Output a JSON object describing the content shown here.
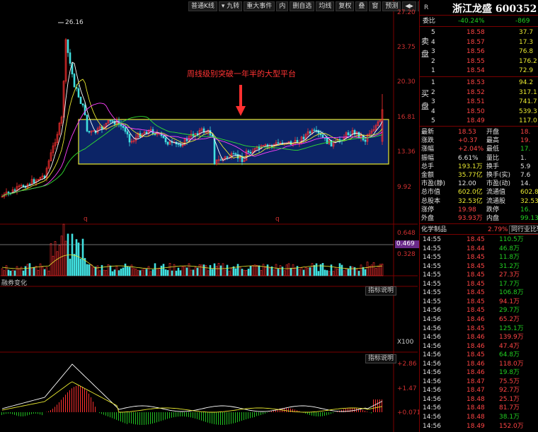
{
  "toolbar": [
    "普通K线",
    "▾ 九转",
    "重大事件",
    "内",
    "删自选",
    "均线",
    "复权",
    "叠",
    "窗",
    "预测",
    "◀▸",
    "▾"
  ],
  "price_axis": [
    "27.20",
    "23.75",
    "20.30",
    "16.81",
    "13.36",
    "9.92"
  ],
  "peak_label": "26.16",
  "annotation": "周线级别突破一年半的大型平台",
  "q_markers": [
    "q",
    "q"
  ],
  "vol_axis": [
    "0.648",
    "0.469",
    "0.328"
  ],
  "panel2": {
    "title": "融券变化",
    "btn": "指标说明",
    "axis": "X100"
  },
  "panel3": {
    "btn": "指标说明",
    "axis": [
      "+2.86",
      "+1.47",
      "+0.071"
    ]
  },
  "colors": {
    "up": "#ff3030",
    "down": "#40e0e0",
    "box": "#0c2466",
    "box_border": "#e8e830",
    "ma1": "#ffffff",
    "ma2": "#e8e830",
    "ma3": "#ff40ff",
    "ma4": "#30e030"
  },
  "quote": {
    "tag": "R",
    "name": "浙江龙盛",
    "code": "600352",
    "weibi_label": "委比",
    "weibi": "-40.24%",
    "weicha": "-869",
    "sell_label": [
      "卖",
      "盘"
    ],
    "buy_label": [
      "买",
      "盘"
    ],
    "sell": [
      {
        "lvl": "5",
        "price": "18.58",
        "vol": "37.7"
      },
      {
        "lvl": "4",
        "price": "18.57",
        "vol": "17.3"
      },
      {
        "lvl": "3",
        "price": "18.56",
        "vol": "76.8"
      },
      {
        "lvl": "2",
        "price": "18.55",
        "vol": "176.2"
      },
      {
        "lvl": "1",
        "price": "18.54",
        "vol": "72.9"
      }
    ],
    "buy": [
      {
        "lvl": "1",
        "price": "18.53",
        "vol": "94.2"
      },
      {
        "lvl": "2",
        "price": "18.52",
        "vol": "317.1"
      },
      {
        "lvl": "3",
        "price": "18.51",
        "vol": "741.7"
      },
      {
        "lvl": "4",
        "price": "18.50",
        "vol": "539.3"
      },
      {
        "lvl": "5",
        "price": "18.49",
        "vol": "117.0"
      }
    ],
    "stats": [
      {
        "l1": "最新",
        "v1": "18.53",
        "c1": "red",
        "l2": "开盘",
        "v2": "18.",
        "c2": "red"
      },
      {
        "l1": "涨跌",
        "v1": "+0.37",
        "c1": "red",
        "l2": "最高",
        "v2": "19.",
        "c2": "red"
      },
      {
        "l1": "涨幅",
        "v1": "+2.04%",
        "c1": "red",
        "l2": "最低",
        "v2": "17.",
        "c2": "green"
      },
      {
        "l1": "振幅",
        "v1": "6.61%",
        "c1": "white",
        "l2": "量比",
        "v2": "1.",
        "c2": "white"
      },
      {
        "l1": "总手",
        "v1": "193.1万",
        "c1": "yellow",
        "l2": "换手",
        "v2": "5.9",
        "c2": "white"
      },
      {
        "l1": "金额",
        "v1": "35.77亿",
        "c1": "yellow",
        "l2": "换手(实)",
        "v2": "7.6",
        "c2": "white"
      },
      {
        "l1": "市盈(静)",
        "v1": "12.00",
        "c1": "white",
        "l2": "市盈(动)",
        "v2": "14.",
        "c2": "white"
      },
      {
        "l1": "总市值",
        "v1": "602.0亿",
        "c1": "yellow",
        "l2": "流通值",
        "v2": "602.8",
        "c2": "yellow"
      },
      {
        "l1": "总股本",
        "v1": "32.53亿",
        "c1": "yellow",
        "l2": "流通股",
        "v2": "32.53",
        "c2": "yellow"
      },
      {
        "l1": "涨停",
        "v1": "19.98",
        "c1": "red",
        "l2": "跌停",
        "v2": "16.",
        "c2": "green"
      },
      {
        "l1": "外盘",
        "v1": "93.93万",
        "c1": "red",
        "l2": "内盘",
        "v2": "99.13",
        "c2": "green"
      }
    ],
    "industry": {
      "name": "化学制品",
      "pct": "2.79%",
      "btn": "同行业比较"
    },
    "ticks": [
      {
        "t": "14:55",
        "p": "18.45",
        "v": "110.5万",
        "c": "green"
      },
      {
        "t": "14:55",
        "p": "18.44",
        "v": "46.8万",
        "c": "green"
      },
      {
        "t": "14:55",
        "p": "18.45",
        "v": "11.8万",
        "c": "green"
      },
      {
        "t": "14:55",
        "p": "18.45",
        "v": "31.2万",
        "c": "green"
      },
      {
        "t": "14:55",
        "p": "18.45",
        "v": "27.3万",
        "c": "red"
      },
      {
        "t": "14:55",
        "p": "18.45",
        "v": "17.7万",
        "c": "green"
      },
      {
        "t": "14:55",
        "p": "18.45",
        "v": "106.8万",
        "c": "green"
      },
      {
        "t": "14:55",
        "p": "18.45",
        "v": "94.1万",
        "c": "red"
      },
      {
        "t": "14:56",
        "p": "18.45",
        "v": "29.7万",
        "c": "green"
      },
      {
        "t": "14:56",
        "p": "18.46",
        "v": "65.2万",
        "c": "red"
      },
      {
        "t": "14:56",
        "p": "18.45",
        "v": "125.1万",
        "c": "green"
      },
      {
        "t": "14:56",
        "p": "18.46",
        "v": "139.9万",
        "c": "red"
      },
      {
        "t": "14:56",
        "p": "18.46",
        "v": "47.4万",
        "c": "red"
      },
      {
        "t": "14:56",
        "p": "18.45",
        "v": "64.8万",
        "c": "green"
      },
      {
        "t": "14:56",
        "p": "18.46",
        "v": "118.0万",
        "c": "red"
      },
      {
        "t": "14:56",
        "p": "18.46",
        "v": "19.8万",
        "c": "green"
      },
      {
        "t": "14:56",
        "p": "18.47",
        "v": "75.5万",
        "c": "red"
      },
      {
        "t": "14:56",
        "p": "18.47",
        "v": "92.7万",
        "c": "red"
      },
      {
        "t": "14:56",
        "p": "18.48",
        "v": "25.1万",
        "c": "red"
      },
      {
        "t": "14:56",
        "p": "18.48",
        "v": "81.7万",
        "c": "red"
      },
      {
        "t": "14:56",
        "p": "18.48",
        "v": "38.1万",
        "c": "green"
      },
      {
        "t": "14:56",
        "p": "18.49",
        "v": "152.0万",
        "c": "red"
      }
    ]
  }
}
